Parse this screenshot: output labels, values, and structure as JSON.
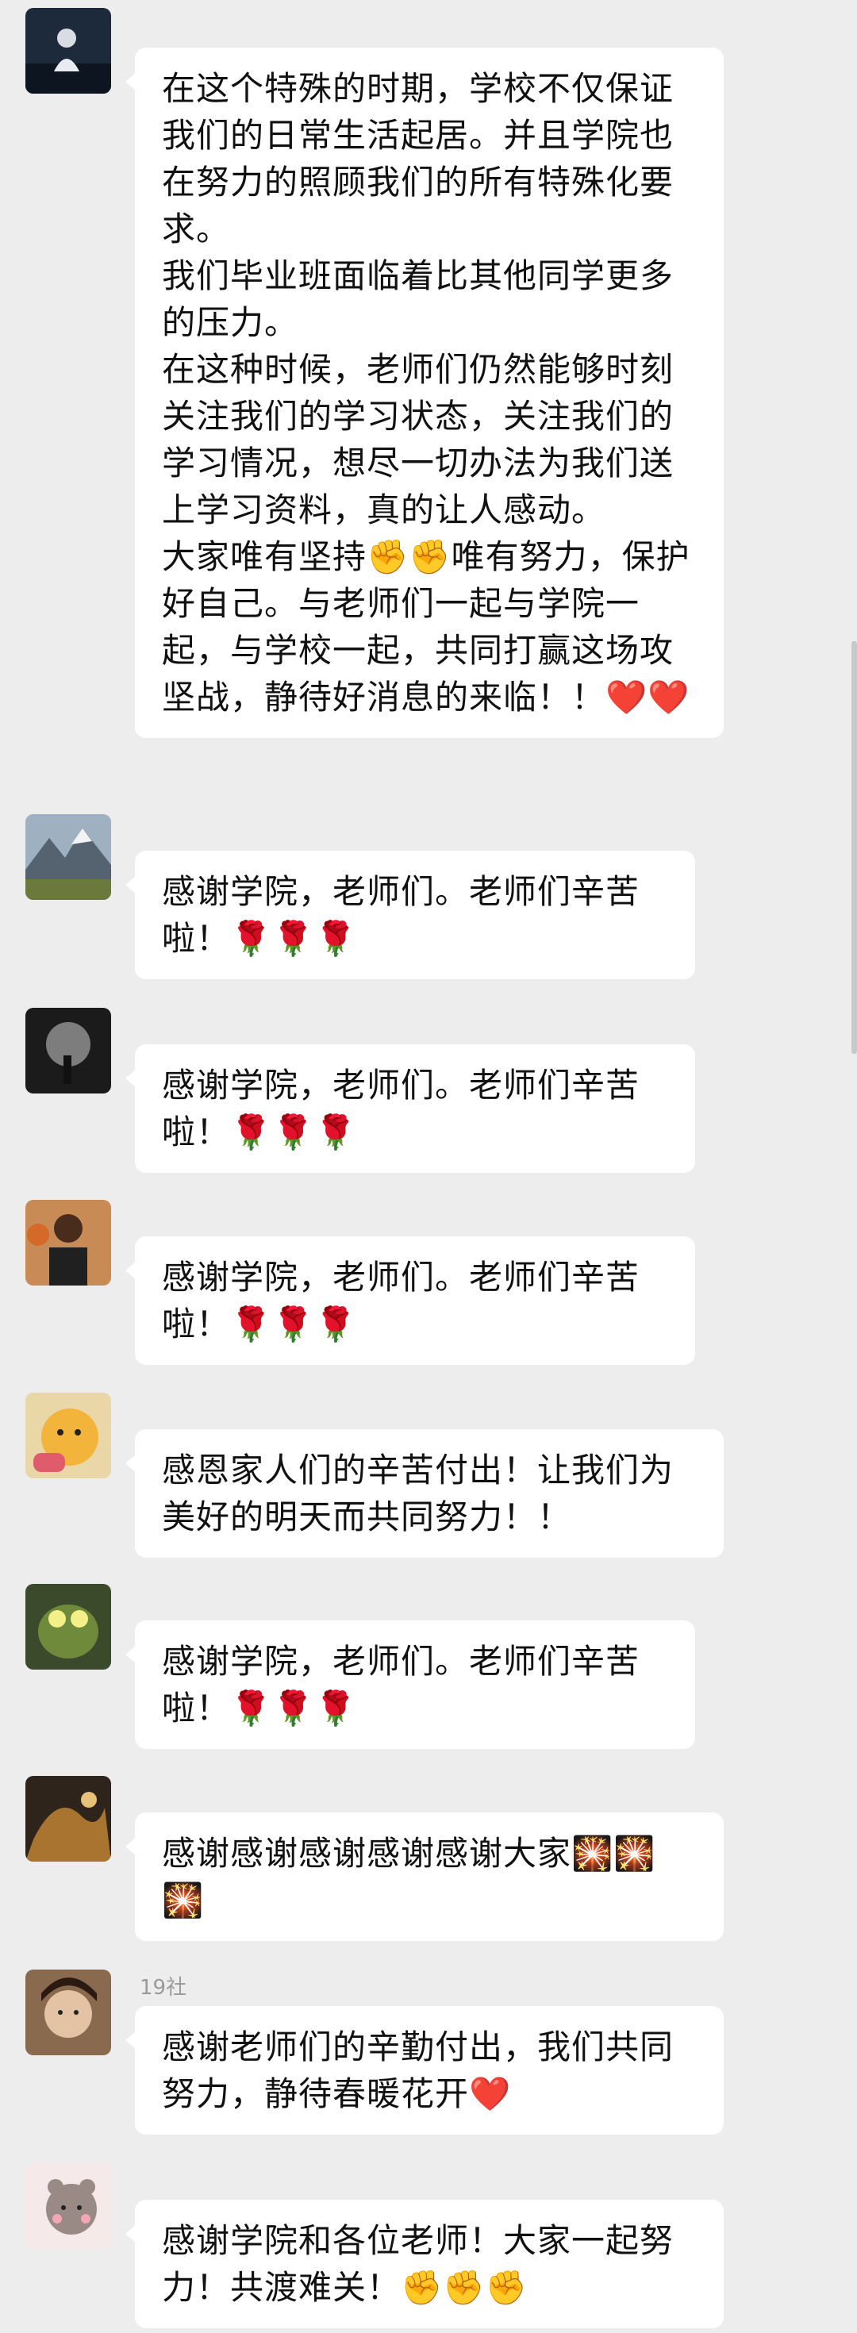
{
  "messages": [
    {
      "sender": "",
      "paragraphs": [
        "在这个特殊的时期，学校不仅保证我们的日常生活起居。并且学院也在努力的照顾我们的所有特殊化要求。",
        "我们毕业班面临着比其他同学更多的压力。",
        "在这种时候，老师们仍然能够时刻关注我们的学习状态，关注我们的学习情况，想尽一切办法为我们送上学习资料，真的让人感动。",
        "大家唯有坚持✊✊唯有努力，保护好自己。与老师们一起与学院一起，与学校一起，共同打赢这场攻坚战，静待好消息的来临！！❤️❤️"
      ]
    },
    {
      "sender": "",
      "paragraphs": [
        "感谢学院，老师们。老师们辛苦啦！🌹🌹🌹"
      ]
    },
    {
      "sender": "",
      "paragraphs": [
        "感谢学院，老师们。老师们辛苦啦！🌹🌹🌹"
      ]
    },
    {
      "sender": "",
      "paragraphs": [
        "感谢学院，老师们。老师们辛苦啦！🌹🌹🌹"
      ]
    },
    {
      "sender": "",
      "paragraphs": [
        "感恩家人们的辛苦付出！让我们为美好的明天而共同努力！！"
      ]
    },
    {
      "sender": "",
      "paragraphs": [
        "感谢学院，老师们。老师们辛苦啦！🌹🌹🌹"
      ]
    },
    {
      "sender": "",
      "paragraphs": [
        "感谢感谢感谢感谢感谢大家🎇🎇🎇"
      ]
    },
    {
      "sender": "19社",
      "paragraphs": [
        "感谢老师们的辛勤付出，我们共同努力，静待春暖花开❤️"
      ]
    },
    {
      "sender": "",
      "paragraphs": [
        "感谢学院和各位老师！大家一起努力！共渡难关！✊✊✊"
      ]
    }
  ],
  "colors": {
    "background": "#ededed",
    "bubble": "#ffffff",
    "text": "#111111"
  },
  "icons": [
    "avatar-image",
    "raised-fist-emoji",
    "red-heart-emoji",
    "rose-emoji",
    "fireworks-emoji"
  ]
}
